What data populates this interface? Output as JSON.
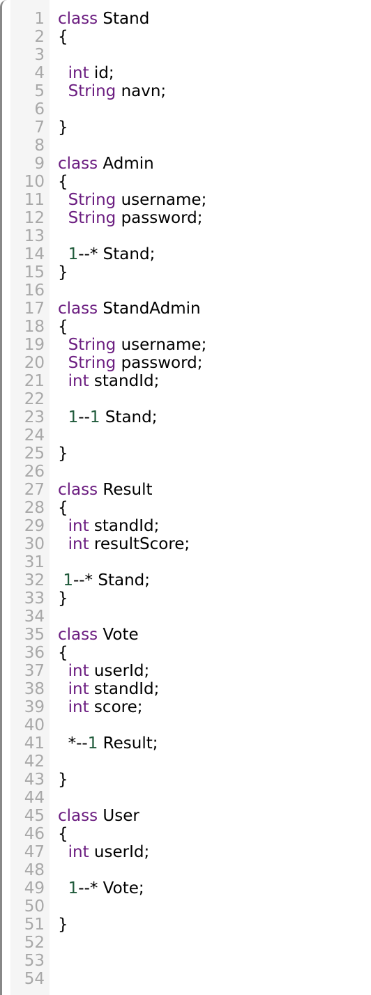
{
  "colors": {
    "keyword": "#6b1d80",
    "number": "#1f5a3a",
    "line_number": "#a8a8a8",
    "gutter": "#f5f5f5"
  },
  "lines": [
    [
      [
        "kw",
        "class"
      ],
      [
        "t",
        " Stand"
      ]
    ],
    [
      [
        "t",
        "{"
      ]
    ],
    [],
    [
      [
        "t",
        "  "
      ],
      [
        "kw",
        "int"
      ],
      [
        "t",
        " id;"
      ]
    ],
    [
      [
        "t",
        "  "
      ],
      [
        "kw",
        "String"
      ],
      [
        "t",
        " navn;"
      ]
    ],
    [],
    [
      [
        "t",
        "}"
      ]
    ],
    [],
    [
      [
        "kw",
        "class"
      ],
      [
        "t",
        " Admin"
      ]
    ],
    [
      [
        "t",
        "{"
      ]
    ],
    [
      [
        "t",
        "  "
      ],
      [
        "kw",
        "String"
      ],
      [
        "t",
        " username;"
      ]
    ],
    [
      [
        "t",
        "  "
      ],
      [
        "kw",
        "String"
      ],
      [
        "t",
        " password;"
      ]
    ],
    [],
    [
      [
        "t",
        "  "
      ],
      [
        "num",
        "1"
      ],
      [
        "t",
        "--* Stand;"
      ]
    ],
    [
      [
        "t",
        "}"
      ]
    ],
    [],
    [
      [
        "kw",
        "class"
      ],
      [
        "t",
        " StandAdmin"
      ]
    ],
    [
      [
        "t",
        "{"
      ]
    ],
    [
      [
        "t",
        "  "
      ],
      [
        "kw",
        "String"
      ],
      [
        "t",
        " username;"
      ]
    ],
    [
      [
        "t",
        "  "
      ],
      [
        "kw",
        "String"
      ],
      [
        "t",
        " password;"
      ]
    ],
    [
      [
        "t",
        "  "
      ],
      [
        "kw",
        "int"
      ],
      [
        "t",
        " standId;"
      ]
    ],
    [],
    [
      [
        "t",
        "  "
      ],
      [
        "num",
        "1"
      ],
      [
        "t",
        "--"
      ],
      [
        "num",
        "1"
      ],
      [
        "t",
        " Stand;"
      ]
    ],
    [],
    [
      [
        "t",
        "}"
      ]
    ],
    [],
    [
      [
        "kw",
        "class"
      ],
      [
        "t",
        " Result"
      ]
    ],
    [
      [
        "t",
        "{"
      ]
    ],
    [
      [
        "t",
        "  "
      ],
      [
        "kw",
        "int"
      ],
      [
        "t",
        " standId;"
      ]
    ],
    [
      [
        "t",
        "  "
      ],
      [
        "kw",
        "int"
      ],
      [
        "t",
        " resultScore;"
      ]
    ],
    [],
    [
      [
        "t",
        " "
      ],
      [
        "num",
        "1"
      ],
      [
        "t",
        "--* Stand;"
      ]
    ],
    [
      [
        "t",
        "}"
      ]
    ],
    [],
    [
      [
        "kw",
        "class"
      ],
      [
        "t",
        " Vote"
      ]
    ],
    [
      [
        "t",
        "{"
      ]
    ],
    [
      [
        "t",
        "  "
      ],
      [
        "kw",
        "int"
      ],
      [
        "t",
        " userId;"
      ]
    ],
    [
      [
        "t",
        "  "
      ],
      [
        "kw",
        "int"
      ],
      [
        "t",
        " standId;"
      ]
    ],
    [
      [
        "t",
        "  "
      ],
      [
        "kw",
        "int"
      ],
      [
        "t",
        " score;"
      ]
    ],
    [],
    [
      [
        "t",
        "  *--"
      ],
      [
        "num",
        "1"
      ],
      [
        "t",
        " Result;"
      ]
    ],
    [],
    [
      [
        "t",
        "}"
      ]
    ],
    [],
    [
      [
        "kw",
        "class"
      ],
      [
        "t",
        " User"
      ]
    ],
    [
      [
        "t",
        "{"
      ]
    ],
    [
      [
        "t",
        "  "
      ],
      [
        "kw",
        "int"
      ],
      [
        "t",
        " userId;"
      ]
    ],
    [],
    [
      [
        "t",
        "  "
      ],
      [
        "num",
        "1"
      ],
      [
        "t",
        "--* Vote;"
      ]
    ],
    [],
    [
      [
        "t",
        "}"
      ]
    ],
    [],
    [],
    []
  ]
}
